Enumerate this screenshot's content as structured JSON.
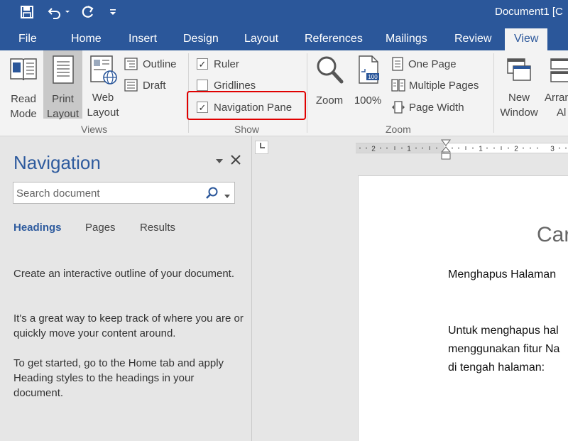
{
  "titlebar": {
    "document_title": "Document1 [C"
  },
  "tabs": [
    "File",
    "Home",
    "Insert",
    "Design",
    "Layout",
    "References",
    "Mailings",
    "Review",
    "View"
  ],
  "active_tab": "View",
  "ribbon": {
    "views": {
      "group_label": "Views",
      "read_mode": [
        "Read",
        "Mode"
      ],
      "print_layout": [
        "Print",
        "Layout"
      ],
      "web_layout": [
        "Web",
        "Layout"
      ],
      "outline": "Outline",
      "draft": "Draft"
    },
    "show": {
      "group_label": "Show",
      "ruler": "Ruler",
      "gridlines": "Gridlines",
      "navigation_pane": "Navigation Pane",
      "ruler_checked": true,
      "gridlines_checked": false,
      "navigation_pane_checked": true
    },
    "zoom": {
      "group_label": "Zoom",
      "zoom": "Zoom",
      "hundred": "100%",
      "one_page": "One Page",
      "multiple_pages": "Multiple Pages",
      "page_width": "Page Width"
    },
    "window": {
      "new_window": [
        "New",
        "Window"
      ],
      "arrange_all": [
        "Arran",
        "Al"
      ]
    }
  },
  "navigation": {
    "title": "Navigation",
    "search_placeholder": "Search document",
    "tabs": [
      "Headings",
      "Pages",
      "Results"
    ],
    "active_tab": "Headings",
    "paragraphs": [
      "Create an interactive outline of your document.",
      "It's a great way to keep track of where you are or quickly move your content around.",
      "To get started, go to the Home tab and apply Heading styles to the headings in your document."
    ]
  },
  "ruler": {
    "labels": [
      "2",
      "1",
      "1",
      "2",
      "3"
    ]
  },
  "document": {
    "title": "Car",
    "lines": [
      "Menghapus Halaman",
      "Untuk menghapus hal",
      "menggunakan fitur Na",
      "di tengah halaman:"
    ]
  },
  "colors": {
    "brand_blue": "#2b579a",
    "highlight_red": "#e00000"
  }
}
